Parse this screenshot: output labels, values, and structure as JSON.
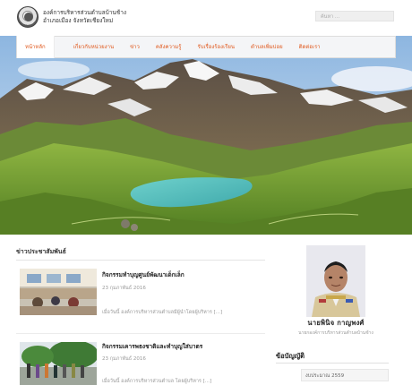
{
  "header": {
    "site_name_line1": "องค์การบริหารส่วนตำบลบ้านช้าง",
    "site_name_line2": "อำเภอเมือง จังหวัดเชียงใหม่",
    "search_placeholder": "ค้นหา ..."
  },
  "nav": {
    "items": [
      {
        "label": "หน้าหลัก"
      },
      {
        "label": "เกี่ยวกับหน่วยงาน"
      },
      {
        "label": "ข่าว"
      },
      {
        "label": "คลังความรู้"
      },
      {
        "label": "รับเรื่องร้องเรียน"
      },
      {
        "label": "ตำบลเพิ่มบ่อย"
      },
      {
        "label": "ติดต่อเรา"
      }
    ]
  },
  "main": {
    "section_title": "ข่าวประชาสัมพันธ์",
    "posts": [
      {
        "title": "กิจกรรมทำบุญศูนย์พัฒนาเด็กเล็ก",
        "date": "23 กุมภาพันธ์ 2016",
        "excerpt": "เมื่อวันนี้ องค์การบริหารส่วนตำบลมีผู้นำโดยผู้บริหาร [...]"
      },
      {
        "title": "กิจกรรมเคารพธงชาติและทำบุญใส่บาตร",
        "date": "23 กุมภาพันธ์ 2016",
        "excerpt": "เมื่อวันนี้ องค์การบริหารส่วนตำบล โดยผู้บริหาร [...]"
      }
    ]
  },
  "sidebar": {
    "person_name": "นายพินิจ กาญพงศ์",
    "person_role": "นายกองค์การบริหารส่วนตำบลบ้านช้าง",
    "widget_title": "ข้อบัญญัติ",
    "select_value": "งบประมาณ 2559"
  },
  "colors": {
    "accent": "#e05a1f",
    "lake": "#5fc6c4",
    "sky": "#a9c8e8"
  }
}
